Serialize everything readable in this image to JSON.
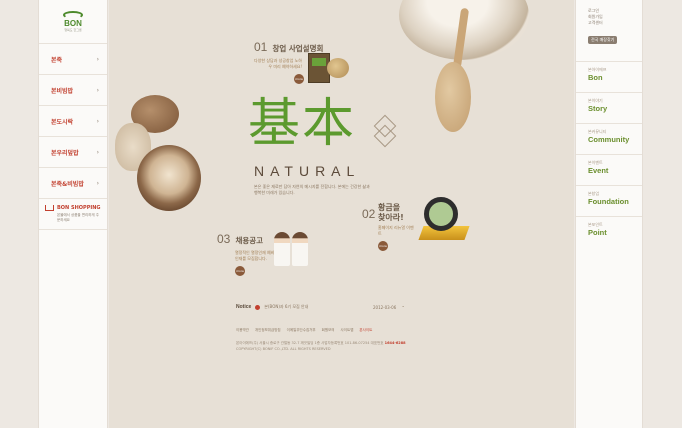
{
  "brand": {
    "logo": "BON",
    "logo_sub": "행복도 한그릇"
  },
  "left_nav": {
    "items": [
      {
        "label": "본죽"
      },
      {
        "label": "본비빔밥"
      },
      {
        "label": "본도시락"
      },
      {
        "label": "본우리덮밥"
      },
      {
        "label": "본죽&비빔밥"
      }
    ],
    "shop": {
      "title": "BON SHOPPING",
      "desc": "본몰에서 상품을 편리하게 주문하세요"
    }
  },
  "right_nav": {
    "util_links": [
      "로그인",
      "회원가입",
      "고객센터"
    ],
    "util_button": "전국 매장찾기",
    "items": [
      {
        "kr": "본아이에프",
        "en": "Bon"
      },
      {
        "kr": "본이야기",
        "en": "Story"
      },
      {
        "kr": "본커뮤니티",
        "en": "Community"
      },
      {
        "kr": "본이벤트",
        "en": "Event"
      },
      {
        "kr": "본창업",
        "en": "Foundation"
      },
      {
        "kr": "본포인트",
        "en": "Point"
      }
    ]
  },
  "main": {
    "sec1": {
      "num": "01",
      "title": "창업 사업설명회",
      "desc": "다양한 상담과 성공창업 노하우 미리 예약하세요!",
      "more": "more"
    },
    "hero_title": "基本",
    "hero_en": "NATURAL",
    "tagline": "본은 좋은 재료만 담아 자연의 메시지를 전합니다. 본에는 건강한 삶과 행복한 미래가 있습니다.",
    "sec2": {
      "num": "02",
      "title_line1": "황금을",
      "title_line2": "찾아라!",
      "desc": "홈페이지 리뉴얼 이벤트",
      "more": "more"
    },
    "sec3": {
      "num": "03",
      "title": "채용공고",
      "desc": "열정적인 열정인재 예비인재를 모집합니다.",
      "more": "more"
    },
    "notice": {
      "label": "Notice",
      "text": "본(BON)과 6기 모집 안내",
      "date": "2012-03-06"
    },
    "footer_links": [
      "이용약관",
      "개인정보취급방침",
      "이메일무단수집거부",
      "회원모의",
      "사이트맵",
      "본사이트"
    ],
    "footer_info": "본아이에프(주) 서울시 종로구 관철동 32-7 깨끗빌딩 1층 사업자등록번호 101-86-07254 대표번호",
    "phone": "1644-6288",
    "copyright": "COPYRIGHT(C) BONIF CO.,LTD. ALL RIGHTS RESERVED"
  }
}
